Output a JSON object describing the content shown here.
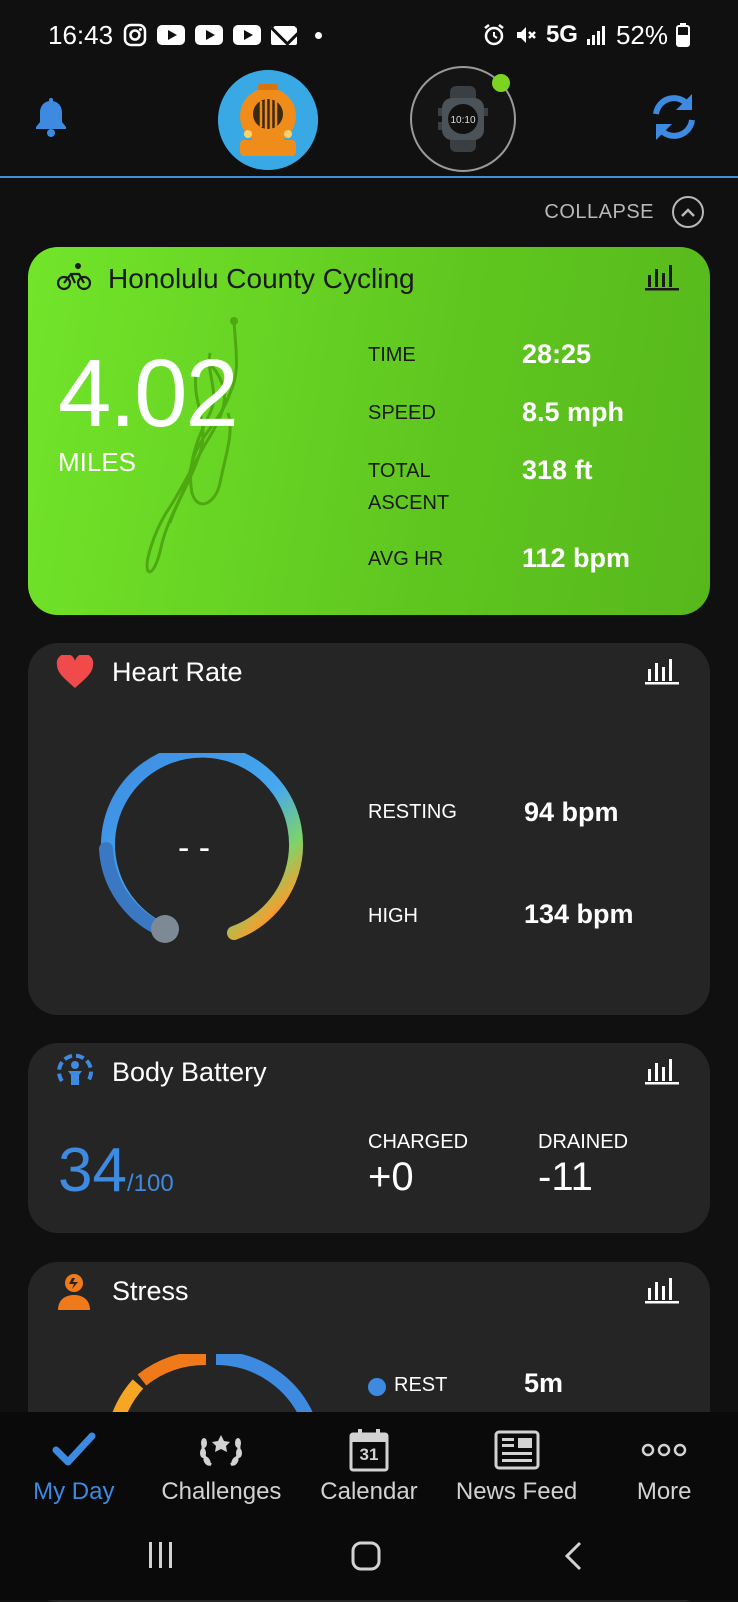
{
  "status_bar": {
    "time": "16:43",
    "network": "5G",
    "battery": "52%"
  },
  "header": {
    "accent": "#3f8fd6"
  },
  "collapse": {
    "label": "COLLAPSE"
  },
  "activity": {
    "title": "Honolulu County Cycling",
    "distance": "4.02",
    "distance_unit": "MILES",
    "stats": [
      {
        "label": "TIME",
        "value": "28:25"
      },
      {
        "label": "SPEED",
        "value": "8.5 mph"
      },
      {
        "label": "TOTAL ASCENT",
        "value": "318 ft"
      },
      {
        "label": "AVG HR",
        "value": "112 bpm"
      }
    ],
    "color": "#6ad626"
  },
  "heart_rate": {
    "title": "Heart Rate",
    "current": "- -",
    "resting_label": "RESTING",
    "resting_value": "94 bpm",
    "high_label": "HIGH",
    "high_value": "134 bpm"
  },
  "body_battery": {
    "title": "Body Battery",
    "value": "34",
    "max": "/100",
    "charged_label": "CHARGED",
    "charged_value": "+0",
    "drained_label": "DRAINED",
    "drained_value": "-11",
    "color": "#3d8ae0"
  },
  "stress": {
    "title": "Stress",
    "rest_label": "REST",
    "rest_value": "5m"
  },
  "nav": {
    "items": [
      {
        "label": "My Day",
        "icon": "check-icon",
        "active": true
      },
      {
        "label": "Challenges",
        "icon": "laurel-icon",
        "active": false
      },
      {
        "label": "Calendar",
        "icon": "calendar-icon",
        "active": false
      },
      {
        "label": "News Feed",
        "icon": "newspaper-icon",
        "active": false
      },
      {
        "label": "More",
        "icon": "more-icon",
        "active": false
      }
    ],
    "calendar_day": "31"
  }
}
